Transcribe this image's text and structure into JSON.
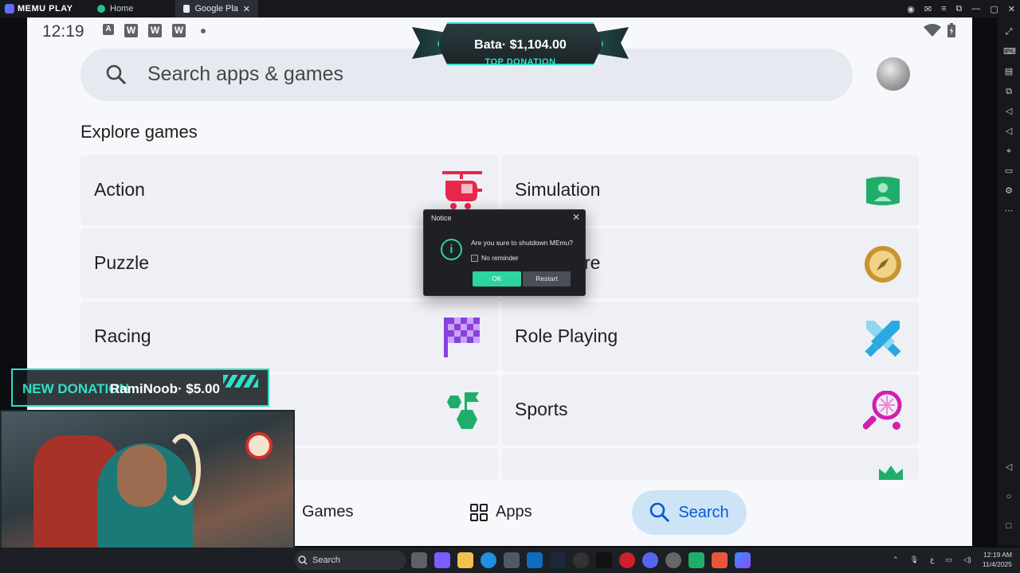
{
  "titlebar": {
    "app_name": "MEMU PLAY",
    "tabs": [
      {
        "label": "Home"
      },
      {
        "label": "Google Play Store"
      }
    ]
  },
  "android": {
    "status": {
      "time": "12:19",
      "left_icons": [
        "A",
        "W",
        "W",
        "W"
      ]
    },
    "search": {
      "placeholder": "Search apps & games"
    },
    "section_title": "Explore games",
    "categories": [
      {
        "label": "Action",
        "icon": "helicopter-icon",
        "color": "#e8284a"
      },
      {
        "label": "Simulation",
        "icon": "simulation-icon",
        "color": "#1fae6a"
      },
      {
        "label": "Puzzle",
        "icon": "puzzle-icon",
        "color": "#cccccc"
      },
      {
        "label": "re",
        "icon": "compass-icon",
        "color": "#c8942f"
      },
      {
        "label": "Racing",
        "icon": "checkered-flag-icon",
        "color": "#8a3fe0"
      },
      {
        "label": "Role Playing",
        "icon": "crossed-swords-icon",
        "color": "#2aa9e0"
      },
      {
        "label": "Sports",
        "icon": "tennis-racket-icon",
        "color": "#d21fb0"
      }
    ],
    "bottom_nav": {
      "games": "Games",
      "apps": "Apps",
      "search": "Search"
    }
  },
  "dialog": {
    "title": "Notice",
    "message": "Are you sure to shutdown MEmu?",
    "checkbox_label": "No reminder",
    "ok_label": "OK",
    "restart_label": "Restart"
  },
  "overlays": {
    "top_donation_amount": "Bata· $1,104.00",
    "top_donation_label": "TOP DONATION",
    "new_donation_label": "NEW DONATION",
    "new_donation_amount": "RamiNoob· $5.00"
  },
  "taskbar": {
    "search_label": "Search",
    "time": "12:19 AM",
    "date": "11/4/2025"
  }
}
